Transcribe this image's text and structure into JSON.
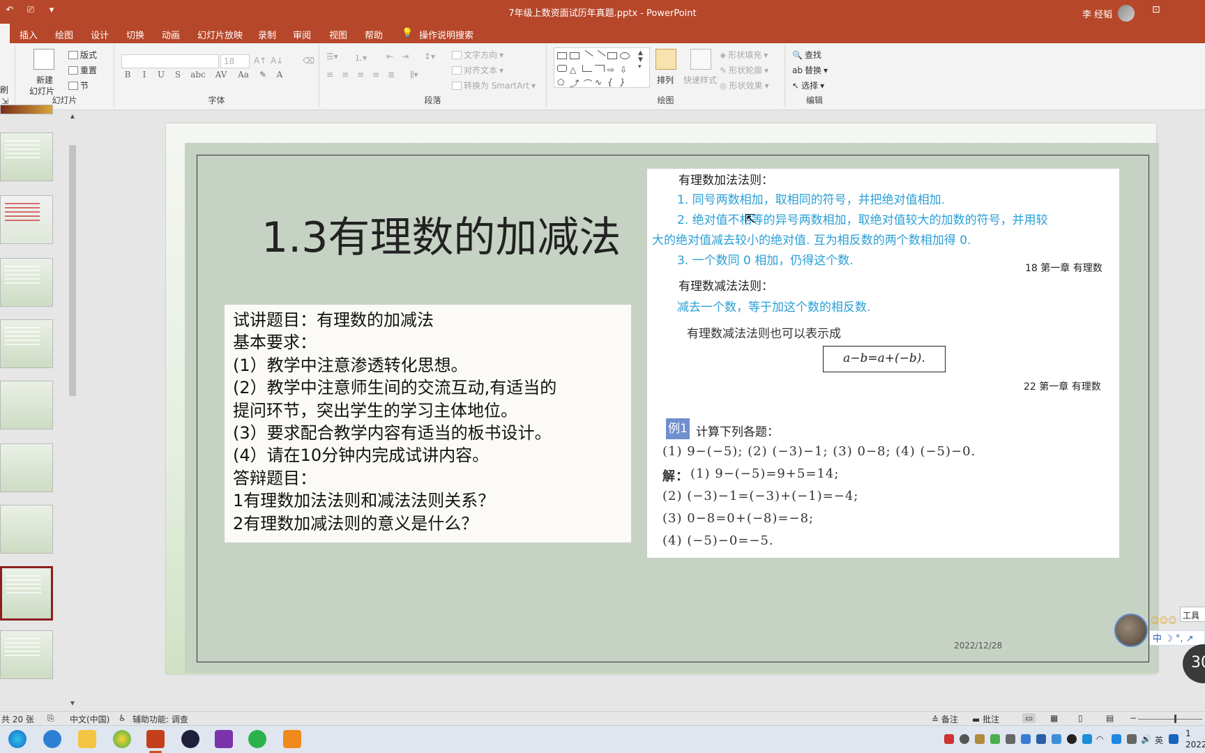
{
  "titlebar": {
    "doc_title": "7年级上数资面试历年真题.pptx  -  PowerPoint",
    "user": "李 经韬",
    "qa_icons": [
      "undo-icon",
      "slideshow-from-start-icon",
      "customize-dropdown-icon"
    ],
    "qa_glyphs": [
      "↶",
      "⎚",
      "▾"
    ],
    "restore_glyph": "⊡"
  },
  "menu": {
    "tabs": [
      "插入",
      "绘图",
      "设计",
      "切换",
      "动画",
      "幻灯片放映",
      "录制",
      "审阅",
      "视图",
      "帮助",
      "操作说明搜索"
    ]
  },
  "ribbon": {
    "clipboard_partial": "刷",
    "slides_group": {
      "new_slide": "新建",
      "new_slide_2": "幻灯片",
      "layout": "版式",
      "reset": "重置",
      "section": "节",
      "label": "幻灯片"
    },
    "font_group": {
      "font_size": "18",
      "label": "字体",
      "format_glyphs": [
        "B",
        "I",
        "U",
        "S",
        "abc",
        "AV",
        "Aa",
        "A"
      ]
    },
    "paragraph_group": {
      "text_direction": "文字方向",
      "align_text": "对齐文本",
      "smartart": "转换为 SmartArt",
      "label": "段落"
    },
    "drawing_group": {
      "arrange": "排列",
      "quick_styles": "快速样式",
      "shape_fill": "形状填充",
      "shape_outline": "形状轮廓",
      "shape_effects": "形状效果",
      "label": "绘图"
    },
    "editing_group": {
      "find": "查找",
      "replace": "替换",
      "select": "选择",
      "label": "编辑"
    }
  },
  "slide": {
    "title": "1.3有理数的加减法",
    "requirements": [
      "试讲题目：有理数的加减法",
      "基本要求：",
      "(1）教学中注意渗透转化思想。",
      "(2）教学中注意师生间的交流互动,有适当的",
      "提问环节，突出学生的学习主体地位。",
      "(3）要求配合教学内容有适当的板书设计。",
      "(4）请在10分钟内完成试讲内容。",
      "答辩题目：",
      "1有理数加法法则和减法法则关系？",
      "2有理数加减法则的意义是什么？"
    ],
    "date": "2022/12/28",
    "textbook": {
      "add_title": "有理数加法法则：",
      "add_rule_1": "1. 同号两数相加，取相同的符号，并把绝对值相加.",
      "add_rule_2a": "2. 绝对值不相等的异号两数相加，取绝对值较大的加数的符号，并用较",
      "add_rule_2b": "大的绝对值减去较小的绝对值. 互为相反数的两个数相加得 0.",
      "add_rule_3": "3. 一个数同 0 相加，仍得这个数.",
      "page_18": "18    第一章    有理数",
      "sub_title": "有理数减法法则：",
      "sub_rule": "减去一个数，等于加这个数的相反数.",
      "sub_alt": "有理数减法法则也可以表示成",
      "formula": "a−b=a+(−b).",
      "page_22": "22    第一章    有理数",
      "example_tag": "例1",
      "example_title": "计算下列各题：",
      "problems": "(1) 9−(−5);     (2) (−3)−1;     (3) 0−8;     (4) (−5)−0.",
      "solution_label": "解：",
      "solution_1": "(1) 9−(−5)=9+5=14;",
      "solution_2": "(2) (−3)−1=(−3)+(−1)=−4;",
      "solution_3": "(3) 0−8=0+(−8)=−8;",
      "solution_4": "(4) (−5)−0=−5."
    }
  },
  "floating": {
    "tool_tip": "工具",
    "ime_bar": "中 ☽ °, ↗",
    "stars": "☺☺☺",
    "timer": "30"
  },
  "statusbar": {
    "slide_count": "共 20 张",
    "language": "中文(中国)",
    "accessibility": "辅助功能: 调查",
    "notes": "备注",
    "comments": "批注"
  },
  "taskbar": {
    "clock_time": "1",
    "clock_date": "2022"
  }
}
